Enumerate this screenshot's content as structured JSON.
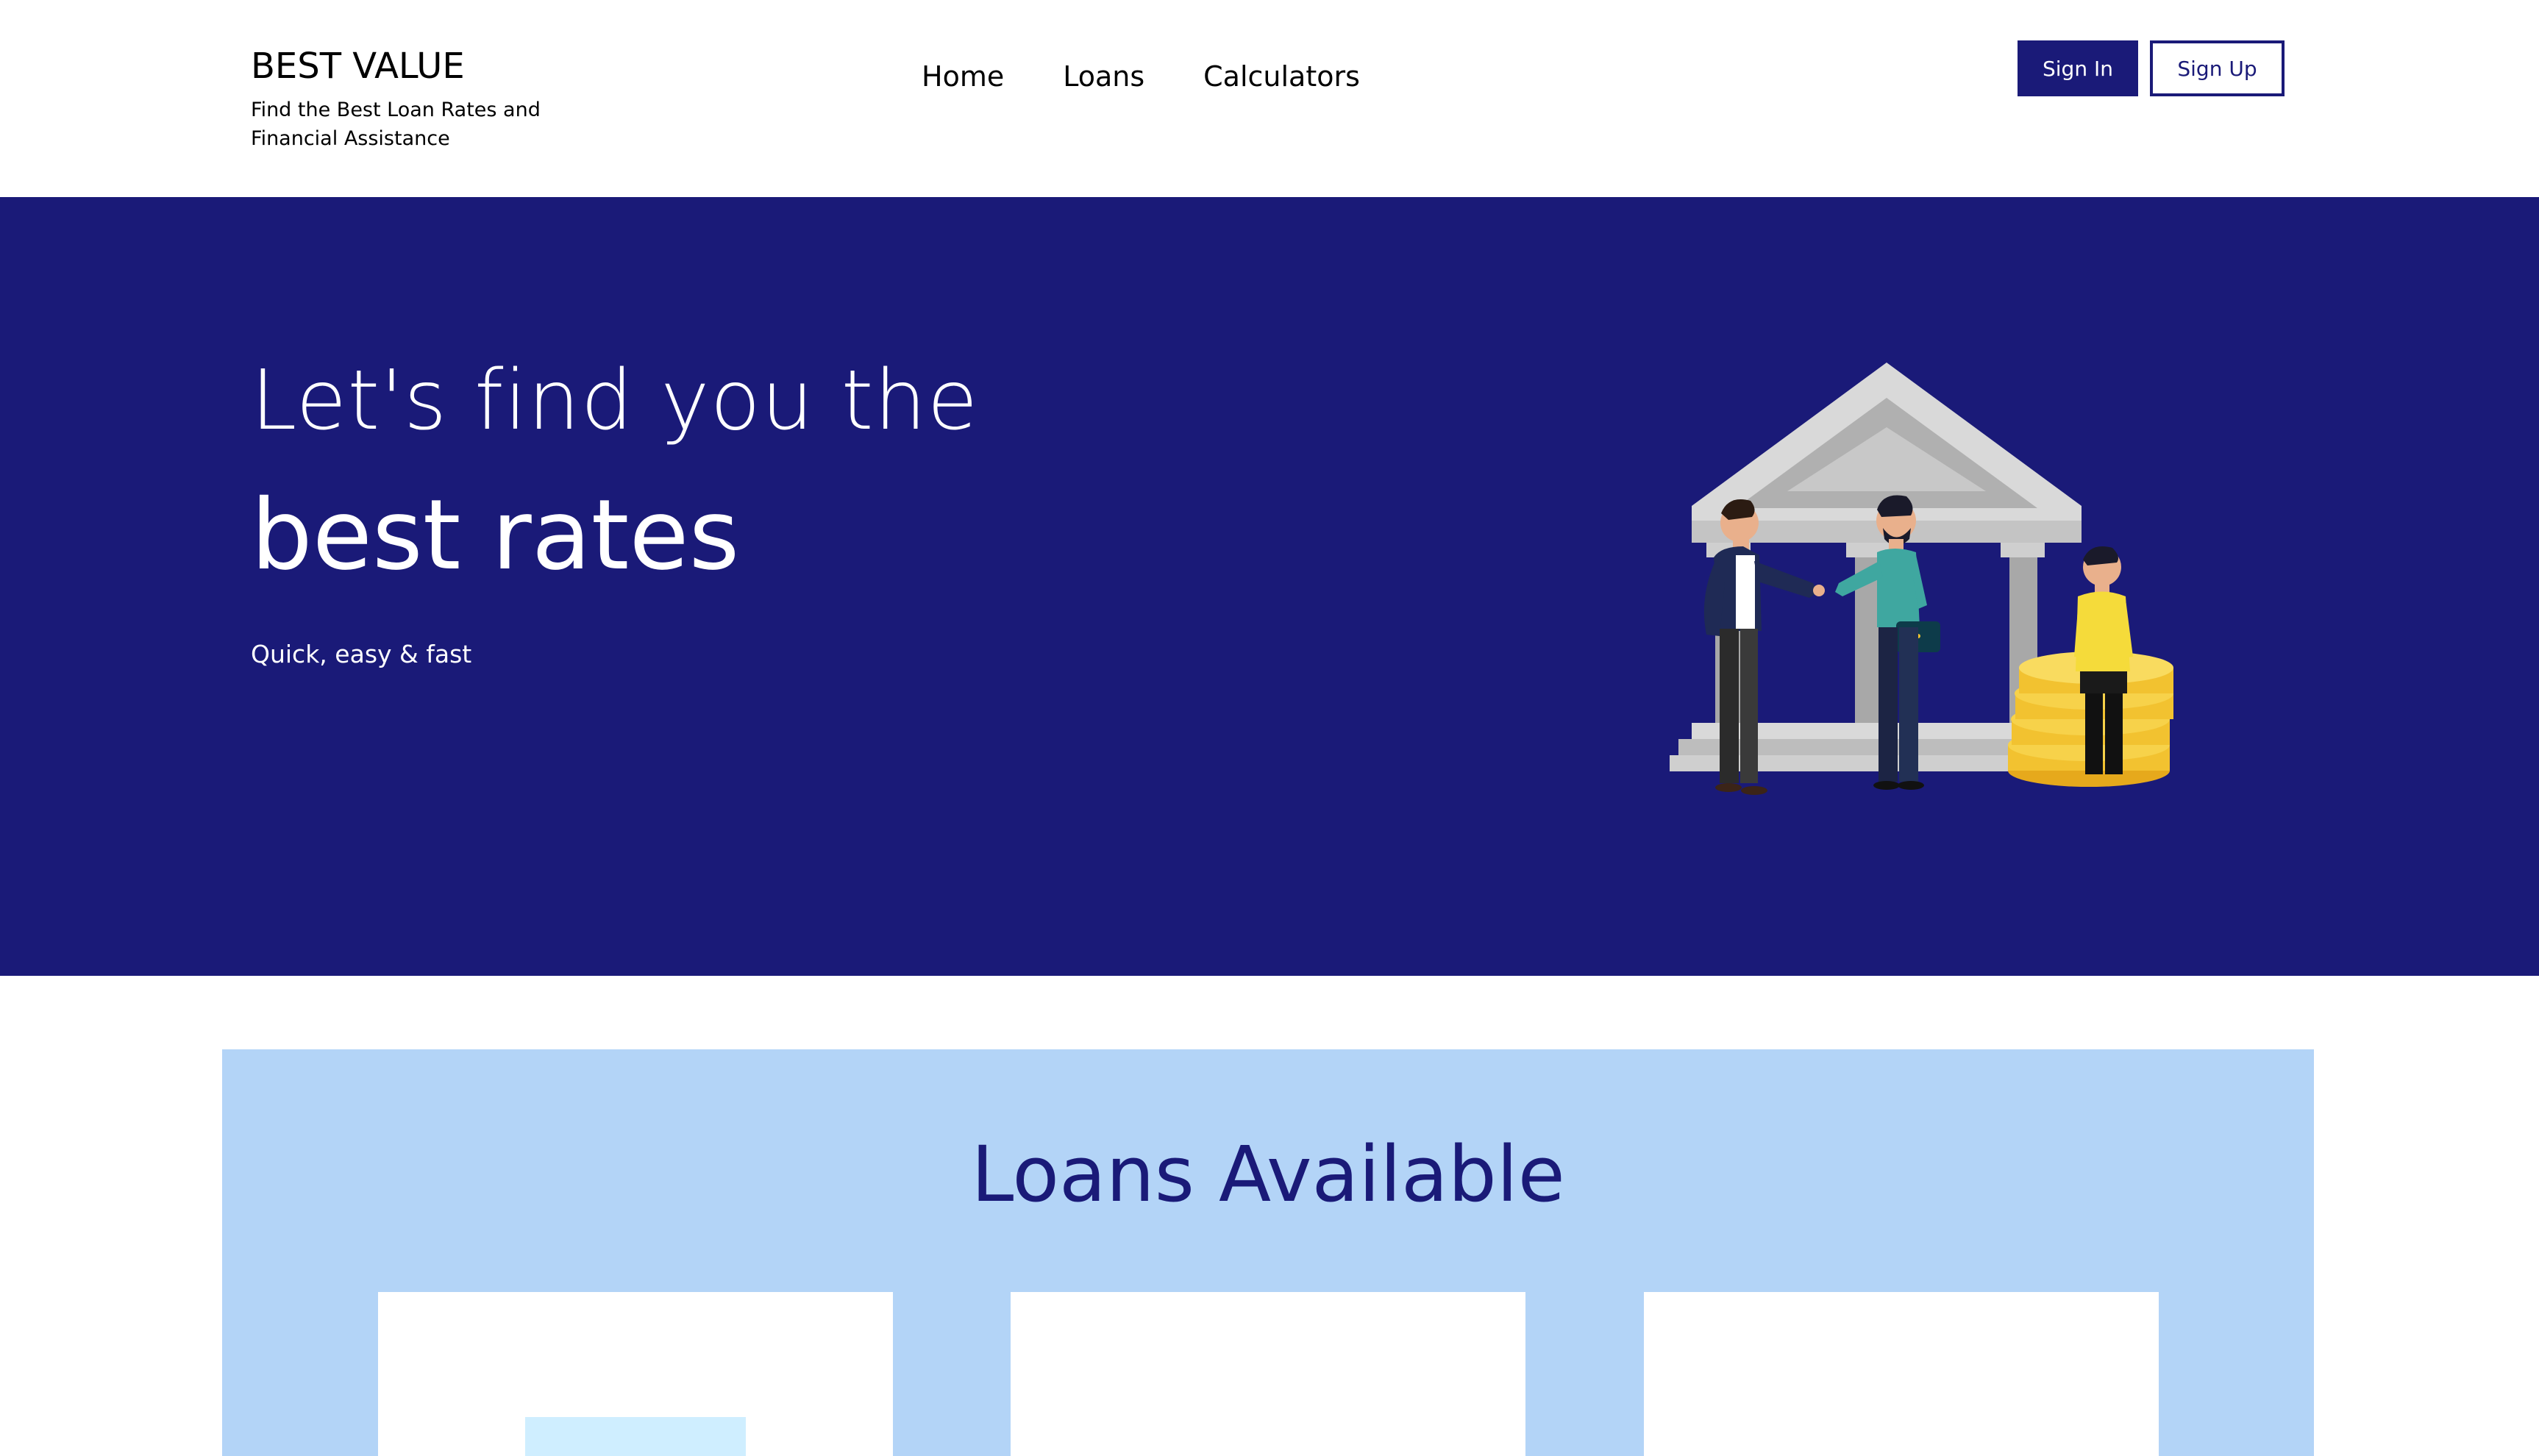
{
  "header": {
    "brand_title": "BEST VALUE",
    "brand_tagline": "Find the Best Loan Rates and Financial Assistance",
    "nav": [
      {
        "label": "Home"
      },
      {
        "label": "Loans"
      },
      {
        "label": "Calculators"
      }
    ],
    "sign_in_label": "Sign In",
    "sign_up_label": "Sign Up"
  },
  "hero": {
    "line1": "Let's find you the",
    "line2": "best rates",
    "subtitle": "Quick, easy & fast",
    "illustration": "bank-handshake-illustration"
  },
  "loans": {
    "title": "Loans Available",
    "cards": [
      {
        "thumb": "loan-image"
      },
      {},
      {}
    ]
  },
  "colors": {
    "primary": "#1a1a78",
    "section_bg": "#b3d4f7",
    "white": "#ffffff"
  }
}
